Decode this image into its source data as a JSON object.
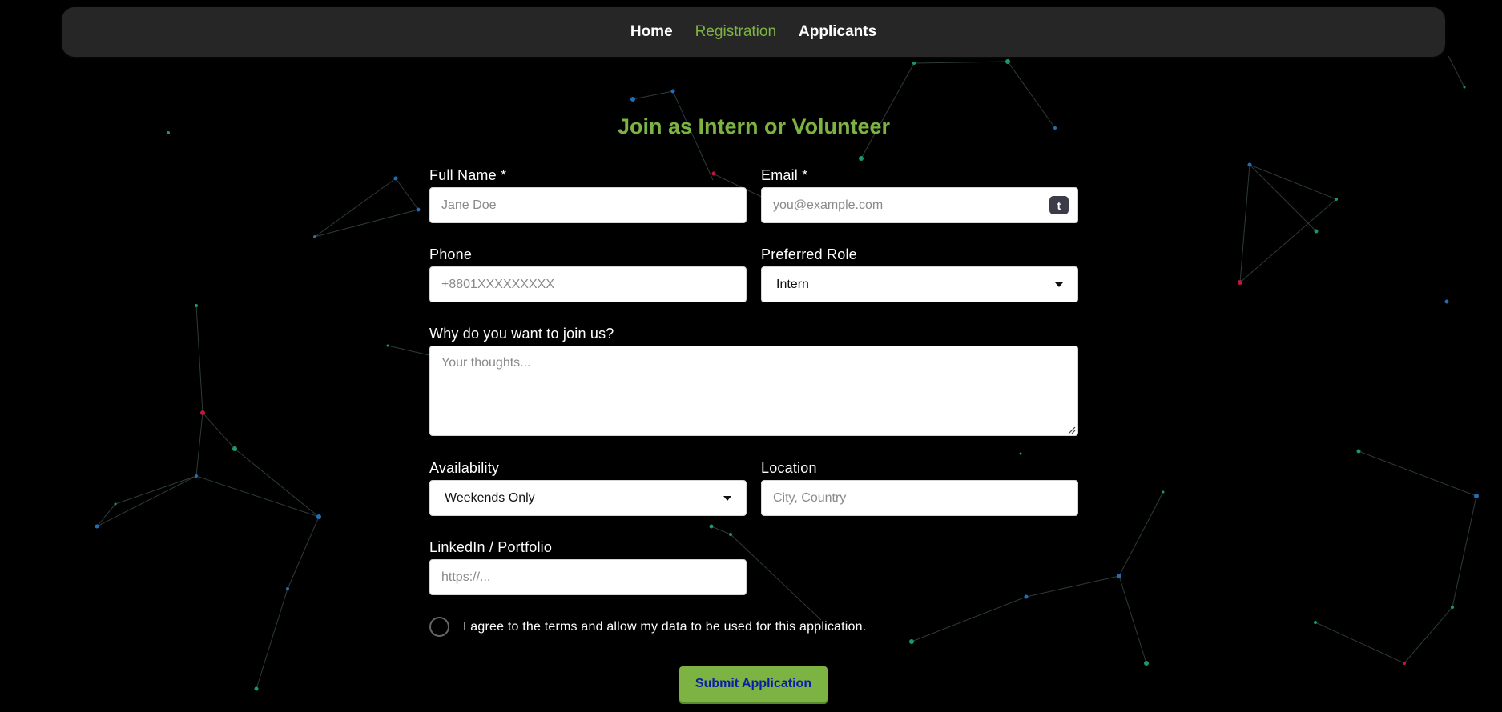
{
  "nav": {
    "links": [
      {
        "label": "Home",
        "active": false
      },
      {
        "label": "Registration",
        "active": true
      },
      {
        "label": "Applicants",
        "active": false
      }
    ]
  },
  "form": {
    "title": "Join as Intern or Volunteer",
    "full_name": {
      "label": "Full Name *",
      "placeholder": "Jane Doe",
      "value": ""
    },
    "email": {
      "label": "Email *",
      "placeholder": "you@example.com",
      "value": "",
      "badge": "t"
    },
    "phone": {
      "label": "Phone",
      "placeholder": "+8801XXXXXXXXX",
      "value": ""
    },
    "preferred_role": {
      "label": "Preferred Role",
      "selected": "Intern"
    },
    "why_join": {
      "label": "Why do you want to join us?",
      "placeholder": "Your thoughts...",
      "value": ""
    },
    "availability": {
      "label": "Availability",
      "selected": "Weekends Only"
    },
    "location": {
      "label": "Location",
      "placeholder": "City, Country",
      "value": ""
    },
    "linkedin": {
      "label": "LinkedIn / Portfolio",
      "placeholder": "https://...",
      "value": ""
    },
    "agree": {
      "label": "I agree to the terms and allow my data to be used for this application.",
      "checked": false
    },
    "submit_label": "Submit Application"
  },
  "colors": {
    "accent": "#7cb342",
    "background": "#000000",
    "navbar": "#262626",
    "submit_text": "#0a1fa8"
  }
}
